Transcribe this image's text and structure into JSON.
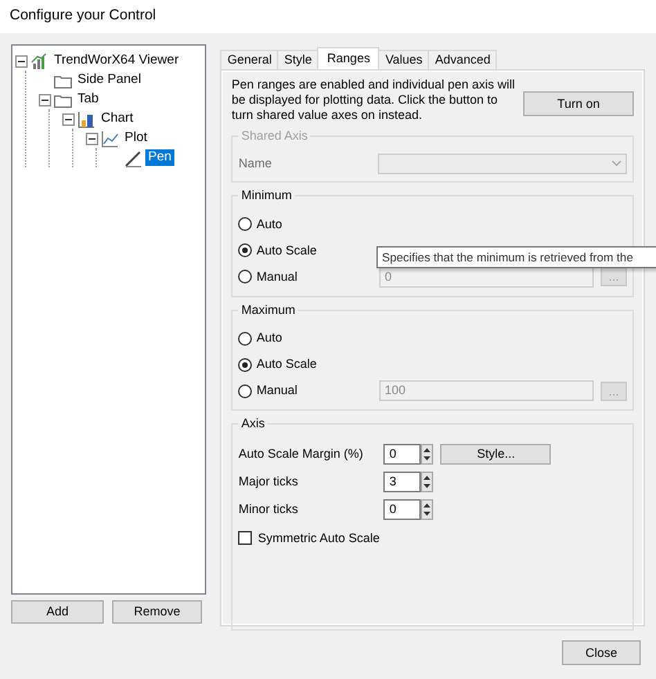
{
  "window": {
    "title": "Configure your Control"
  },
  "tree": [
    {
      "label": "TrendWorX64 Viewer",
      "kind": "viewer",
      "expanded": true,
      "selected": false,
      "children": [
        {
          "label": "Side Panel",
          "kind": "folder",
          "selected": false
        },
        {
          "label": "Tab",
          "kind": "folder",
          "expanded": true,
          "selected": false,
          "children": [
            {
              "label": "Chart",
              "kind": "chart",
              "expanded": true,
              "selected": false,
              "children": [
                {
                  "label": "Plot",
                  "kind": "plot",
                  "expanded": true,
                  "selected": false,
                  "children": [
                    {
                      "label": "Pen",
                      "kind": "pen",
                      "selected": true
                    }
                  ]
                }
              ]
            }
          ]
        }
      ]
    }
  ],
  "tree_buttons": [
    "Add",
    "Remove"
  ],
  "tabs": [
    {
      "label": "General",
      "selected": false
    },
    {
      "label": "Style",
      "selected": false
    },
    {
      "label": "Ranges",
      "selected": true
    },
    {
      "label": "Values",
      "selected": false
    },
    {
      "label": "Advanced",
      "selected": false
    }
  ],
  "ranges": {
    "description": "Pen ranges are enabled and individual pen axis will be displayed for plotting data. Click the button to turn shared value axes on instead.",
    "toggle_button": "Turn on",
    "shared_axis": {
      "title": "Shared Axis",
      "disabled": true,
      "name_label": "Name"
    },
    "minimum": {
      "title": "Minimum",
      "options": [
        {
          "label": "Auto",
          "selected": false
        },
        {
          "label": "Auto Scale",
          "selected": true
        },
        {
          "label": "Manual",
          "selected": false
        }
      ],
      "manual_value": "0",
      "manual_disabled": true,
      "browse_button": "..."
    },
    "maximum": {
      "title": "Maximum",
      "options": [
        {
          "label": "Auto",
          "selected": false
        },
        {
          "label": "Auto Scale",
          "selected": true
        },
        {
          "label": "Manual",
          "selected": false
        }
      ],
      "manual_value": "100",
      "manual_disabled": true,
      "browse_button": "..."
    },
    "axis": {
      "title": "Axis",
      "fields": [
        {
          "label": "Auto Scale Margin (%)",
          "value": "0"
        },
        {
          "label": "Major ticks",
          "value": "3"
        },
        {
          "label": "Minor ticks",
          "value": "0"
        }
      ],
      "style_button": "Style...",
      "symmetric": {
        "label": "Symmetric Auto Scale",
        "checked": false
      }
    }
  },
  "tooltip": "Specifies that the minimum is retrieved from the",
  "close_button": "Close"
}
